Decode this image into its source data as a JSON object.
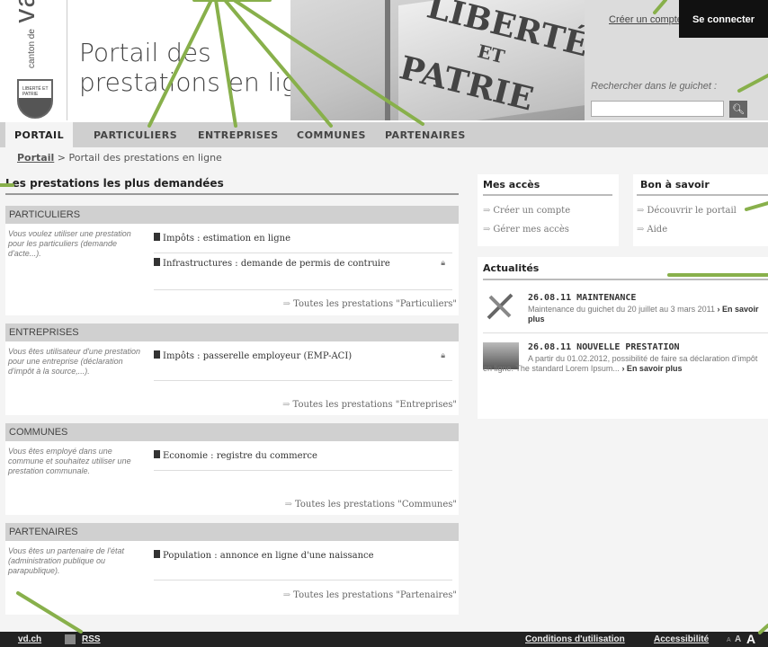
{
  "header": {
    "logo_small": "canton de",
    "logo_big": "vaud",
    "shield_text": "LIBERTÉ ET PATRIE",
    "portal_title_line1": "Portail des",
    "portal_title_line2": "prestations en ligne",
    "flag_text1": "LIBERTÉ",
    "flag_text2": "ET",
    "flag_text3": "PATRIE",
    "create_account": "Créer un compte",
    "login": "Se connecter",
    "search_label": "Rechercher dans le guichet :",
    "search_placeholder": "",
    "search_icon": "search-icon"
  },
  "nav": {
    "items": [
      "PORTAIL",
      "PARTICULIERS",
      "ENTREPRISES",
      "COMMUNES",
      "PARTENAIRES"
    ]
  },
  "breadcrumb": {
    "home": "Portail",
    "sep": ">",
    "current": "Portail des prestations en ligne"
  },
  "main": {
    "title": "Les prestations les plus demandées",
    "sections": [
      {
        "head": "PARTICULIERS",
        "desc": "Vous voulez utiliser une prestation pour les particuliers (demande d'acte...).",
        "services": [
          "Impôts : estimation en ligne",
          "Infrastructures : demande de permis de contruire"
        ],
        "all": "Toutes les prestations \"Particuliers\""
      },
      {
        "head": "ENTREPRISES",
        "desc": "Vous êtes utilisateur d'une prestation pour une entreprise (déclaration d'impôt à la source,...).",
        "services": [
          "Impôts : passerelle employeur (EMP-ACI)"
        ],
        "all": "Toutes les prestations \"Entreprises\""
      },
      {
        "head": "COMMUNES",
        "desc": "Vous êtes employé dans une commune et souhaitez utiliser une prestation communale.",
        "services": [
          "Economie : registre du commerce"
        ],
        "all": "Toutes les prestations \"Communes\""
      },
      {
        "head": "PARTENAIRES",
        "desc": "Vous êtes un partenaire de l'état (administration publique ou parapublique).",
        "services": [
          "Population : annonce en ligne d'une naissance"
        ],
        "all": "Toutes les prestations \"Partenaires\""
      }
    ]
  },
  "sidebar": {
    "acces_title": "Mes accès",
    "acces_links": [
      "Créer un compte",
      "Gérer mes accès"
    ],
    "savoir_title": "Bon à savoir",
    "savoir_links": [
      "Découvrir le portail",
      "Aide"
    ],
    "news_title": "Actualités",
    "news": [
      {
        "title": "26.08.11 MAINTENANCE",
        "text": "Maintenance du guichet du 20 juillet au 3 mars 2011",
        "more": "› En savoir plus"
      },
      {
        "title": "26.08.11 NOUVELLE PRESTATION",
        "text": "A partir du 01.02.2012, possibilité de faire sa déclaration d'impôt en ligne. The standard Lorem Ipsum...",
        "more": "› En savoir plus"
      }
    ]
  },
  "footer": {
    "site": "vd.ch",
    "rss": "RSS",
    "conditions": "Conditions d'utilisation",
    "accessibility": "Accessibilité",
    "font_sizes": [
      "A",
      "A",
      "A"
    ]
  },
  "colors": {
    "annotation": "#88b04b",
    "nav_bg": "#cfcfcf",
    "login_bg": "#111111",
    "footer_bg": "#222222"
  }
}
